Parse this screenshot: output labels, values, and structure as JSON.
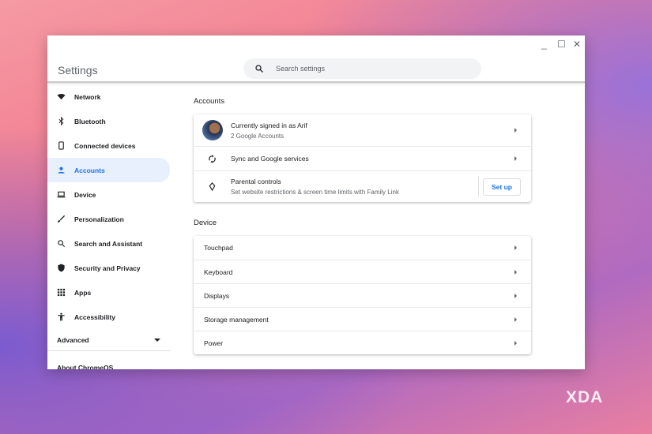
{
  "window": {
    "title": "Settings",
    "search_placeholder": "Search settings",
    "minimize": "_",
    "maximize": "☐",
    "close": "✕"
  },
  "sidebar": {
    "items": [
      {
        "label": "Network",
        "icon": "wifi-icon"
      },
      {
        "label": "Bluetooth",
        "icon": "bluetooth-icon"
      },
      {
        "label": "Connected devices",
        "icon": "phone-icon"
      },
      {
        "label": "Accounts",
        "icon": "person-icon",
        "active": true
      },
      {
        "label": "Device",
        "icon": "laptop-icon"
      },
      {
        "label": "Personalization",
        "icon": "brush-icon"
      },
      {
        "label": "Search and Assistant",
        "icon": "search-icon"
      },
      {
        "label": "Security and Privacy",
        "icon": "shield-icon"
      },
      {
        "label": "Apps",
        "icon": "grid-icon"
      },
      {
        "label": "Accessibility",
        "icon": "accessibility-icon"
      }
    ],
    "advanced": "Advanced",
    "about": "About ChromeOS"
  },
  "accounts": {
    "heading": "Accounts",
    "signed_in": "Currently signed in as Arif",
    "signed_in_sub": "2 Google Accounts",
    "sync": "Sync and Google services",
    "parental": "Parental controls",
    "parental_sub": "Set website restrictions & screen time limits with Family Link",
    "setup": "Set up"
  },
  "device": {
    "heading": "Device",
    "items": [
      "Touchpad",
      "Keyboard",
      "Displays",
      "Storage management",
      "Power"
    ]
  },
  "watermark": "XDA"
}
